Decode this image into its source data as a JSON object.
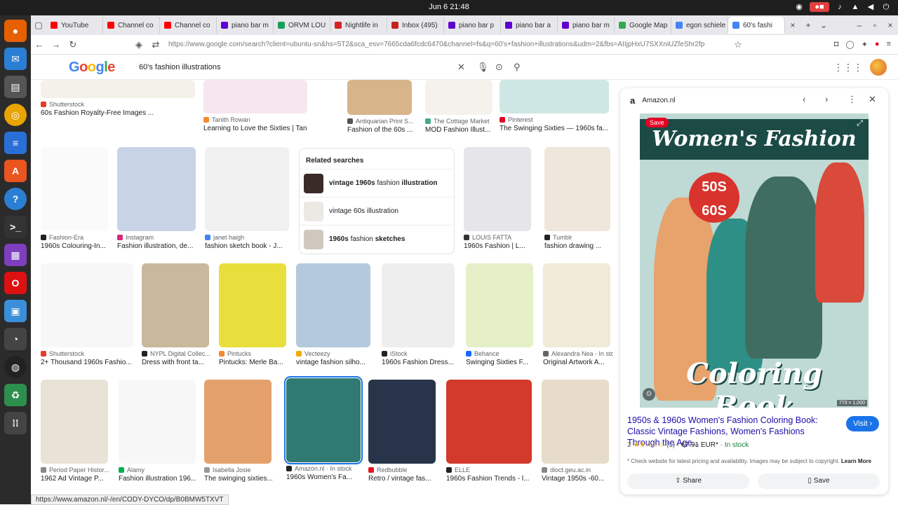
{
  "os": {
    "clock": "Jun 6  21:48"
  },
  "tabs": [
    {
      "label": "YouTube",
      "color": "#ff0000"
    },
    {
      "label": "Channel co",
      "color": "#ff0000"
    },
    {
      "label": "Channel co",
      "color": "#ff0000"
    },
    {
      "label": "piano bar m",
      "color": "#6001d2"
    },
    {
      "label": "ORVM LOU",
      "color": "#1a9e5a"
    },
    {
      "label": "Nightlife in",
      "color": "#d32323"
    },
    {
      "label": "Inbox (495)",
      "color": "#c5221f"
    },
    {
      "label": "piano bar p",
      "color": "#6001d2"
    },
    {
      "label": "piano bar a",
      "color": "#6001d2"
    },
    {
      "label": "piano bar m",
      "color": "#6001d2"
    },
    {
      "label": "Google Map",
      "color": "#34a853"
    },
    {
      "label": "egon schiele",
      "color": "#4285f4"
    },
    {
      "label": "60's fashi",
      "color": "#4285f4"
    }
  ],
  "address": {
    "url": "https://www.google.com/search?client=ubuntu-sn&hs=5T2&sca_esv=7665cda6fcdc6470&channel=fs&q=60's+fashion+illustrations&udm=2&fbs=AIIjpHxU7SXXniUZfeShr2fp"
  },
  "search": {
    "query": "60's fashion illustrations"
  },
  "related": {
    "title": "Related searches",
    "items": [
      {
        "bold": "vintage 1960s",
        "plain": " fashion ",
        "bold2": "illustration"
      },
      {
        "bold": "",
        "plain": "vintage 60s illustration",
        "bold2": ""
      },
      {
        "bold": "1960s",
        "plain": " fashion ",
        "bold2": "sketches"
      }
    ]
  },
  "results": [
    {
      "src": "Shutterstock",
      "title": "60s Fashion Royalty-Free Images ...",
      "color": "#e8392b"
    },
    {
      "src": "Tanith Rowan",
      "title": "Learning to Love the Sixties | Tanith Row...",
      "color": "#f28b30"
    },
    {
      "src": "Antiquarian Print S...",
      "title": "Fashion of the 60s ...",
      "color": "#555"
    },
    {
      "src": "The Cottage Market",
      "title": "MOD Fashion Illust...",
      "color": "#4a8"
    },
    {
      "src": "Pinterest",
      "title": "The Swinging Sixties — 1960s fa...",
      "color": "#e60023"
    },
    {
      "src": "Fashion-Era",
      "title": "1960s Colouring-In...",
      "color": "#222"
    },
    {
      "src": "Instagram",
      "title": "Fashion illustration, de...",
      "color": "#d62976"
    },
    {
      "src": "janet haigh",
      "title": "fashion sketch book - J...",
      "color": "#4285f4"
    },
    {
      "src": "LOUIS FATTA",
      "title": "1960s Fashion | L...",
      "color": "#333"
    },
    {
      "src": "Tumblr",
      "title": "fashion drawing ...",
      "color": "#222"
    },
    {
      "src": "Shutterstock",
      "title": "2+ Thousand 1960s Fashio...",
      "color": "#e8392b"
    },
    {
      "src": "NYPL Digital Collec...",
      "title": "Dress with front ta...",
      "color": "#222"
    },
    {
      "src": "Pintucks",
      "title": "Pintucks: Merle Ba...",
      "color": "#f28b30"
    },
    {
      "src": "Vecteezy",
      "title": "vintage fashion silho...",
      "color": "#f2a900"
    },
    {
      "src": "iStock",
      "title": "1960s Fashion Dress...",
      "color": "#222"
    },
    {
      "src": "Behance",
      "title": "Swinging Sixties F...",
      "color": "#1769ff"
    },
    {
      "src": "Alexandra Nea - In stock",
      "title": "Original Artwork A...",
      "color": "#666"
    },
    {
      "src": "Period Paper Histor...",
      "title": "1962 Ad Vintage P...",
      "color": "#888"
    },
    {
      "src": "Alamy",
      "title": "Fashion illustration 196...",
      "color": "#00b050"
    },
    {
      "src": "Isabella Josie",
      "title": "The swinging sixties...",
      "color": "#999"
    },
    {
      "src": "Amazon.nl · In stock",
      "title": "1960s Women's Fa...",
      "color": "#222"
    },
    {
      "src": "Redbubble",
      "title": "Retro / vintage fas...",
      "color": "#e41321"
    },
    {
      "src": "ELLE",
      "title": "1960s Fashion Trends - l...",
      "color": "#222"
    },
    {
      "src": "dioct.geu.ac.in",
      "title": "Vintage 1950s -60...",
      "color": "#888"
    }
  ],
  "panel": {
    "source": "Amazon.nl",
    "save_badge": "Save",
    "banner": "Women's Fashion",
    "badge_line1": "50S",
    "badge_line2": "60S",
    "coloring": "Coloring Book",
    "dims": "773 × 1,000",
    "title": "1950s & 1960s Women's Fashion Coloring Book: Classic Vintage Fashions, Women's Fashions Through the Age...",
    "visit": "Visit",
    "rating_num": "2",
    "stars": "★★☆☆☆",
    "reviews": "(1)",
    "price": "€7.91 EUR*",
    "stock": "In stock",
    "note": "* Check website for latest pricing and availability. Images may be subject to copyright.",
    "learn_more": "Learn More",
    "share": "Share",
    "save": "Save"
  },
  "status": {
    "url": "https://www.amazon.nl/-/en/CODY-DYCO/dp/B0BMW5TXVT"
  },
  "colors": {
    "accent": "#1a73e8",
    "dock": "#2b2b2b"
  }
}
